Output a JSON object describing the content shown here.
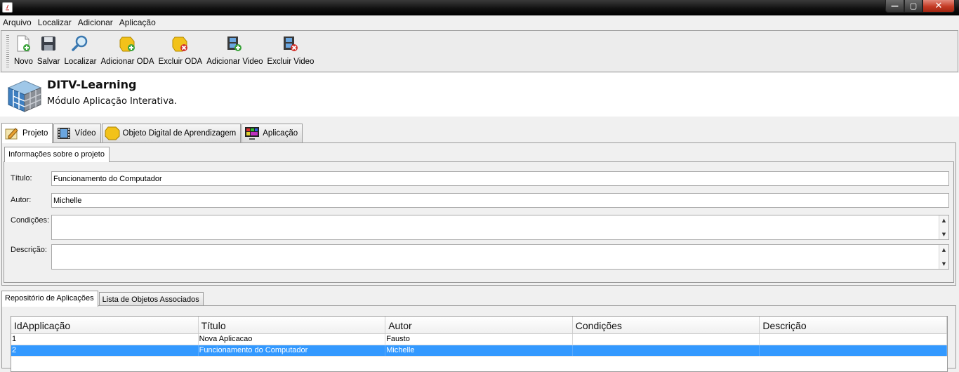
{
  "window": {
    "minimize": "—",
    "maximize": "▢",
    "close": "✕"
  },
  "menu": [
    "Arquivo",
    "Localizar",
    "Adicionar",
    "Aplicação"
  ],
  "toolbar": [
    {
      "label": "Novo",
      "icon": "new-document-icon"
    },
    {
      "label": "Salvar",
      "icon": "floppy-disk-icon"
    },
    {
      "label": "Localizar",
      "icon": "magnifier-icon"
    },
    {
      "label": "Adicionar ODA",
      "icon": "add-oda-icon"
    },
    {
      "label": "Excluir ODA",
      "icon": "delete-oda-icon"
    },
    {
      "label": "Adicionar Video",
      "icon": "add-video-icon"
    },
    {
      "label": "Excluir Video",
      "icon": "delete-video-icon"
    }
  ],
  "banner": {
    "title": "DITV-Learning",
    "subtitle": "Módulo Aplicação Interativa."
  },
  "main_tabs": [
    {
      "label": "Projeto",
      "icon": "project-icon",
      "active": true
    },
    {
      "label": "Vídeo",
      "icon": "film-icon",
      "active": false
    },
    {
      "label": "Objeto Digital de Aprendizagem",
      "icon": "learning-object-icon",
      "active": false
    },
    {
      "label": "Aplicação",
      "icon": "tv-application-icon",
      "active": false
    }
  ],
  "project_info": {
    "tab_label": "Informações sobre o projeto",
    "titulo_label": "Título:",
    "titulo_value": "Funcionamento do Computador",
    "autor_label": "Autor:",
    "autor_value": "Michelle",
    "condicoes_label": "Condições:",
    "condicoes_value": "",
    "descricao_label": "Descrição:",
    "descricao_value": ""
  },
  "bottom_tabs": [
    {
      "label": "Repositório de Aplicações",
      "active": true
    },
    {
      "label": "Lista de Objetos Associados",
      "active": false
    }
  ],
  "table": {
    "columns": [
      "IdApplicação",
      "Título",
      "Autor",
      "Condições",
      "Descrição"
    ],
    "rows": [
      [
        "1",
        "Nova Aplicacao",
        "Fausto",
        "",
        ""
      ],
      [
        "2",
        "Funcionamento do Computador",
        "Michelle",
        "",
        ""
      ]
    ],
    "selected_row": 1
  },
  "colors": {
    "selection": "#3399ff",
    "close_button": "#c43a24"
  }
}
